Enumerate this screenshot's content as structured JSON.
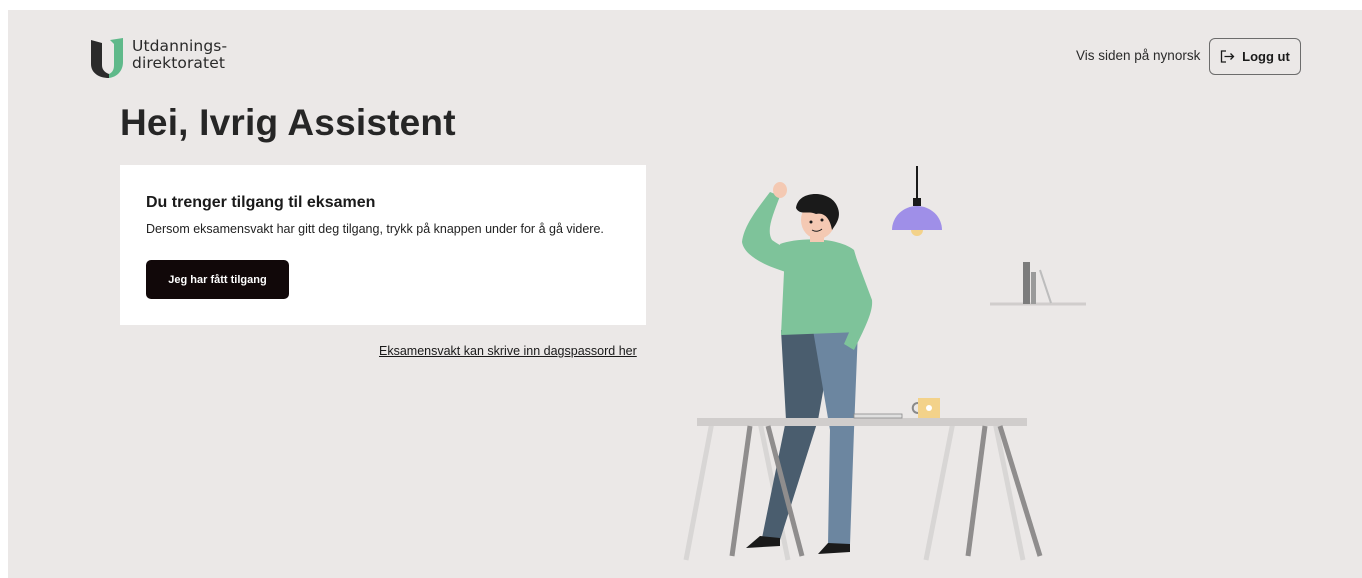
{
  "header": {
    "logo_line1": "Utdannings-",
    "logo_line2": "direktoratet",
    "language_link": "Vis siden på nynorsk",
    "logout_label": "Logg ut"
  },
  "main": {
    "greeting": "Hei, Ivrig Assistent",
    "card": {
      "title": "Du trenger tilgang til eksamen",
      "text": "Dersom eksamensvakt har gitt deg tilgang, trykk på knappen under for å gå videre.",
      "button_label": "Jeg har fått tilgang"
    },
    "code_link": "Eksamensvakt kan skrive inn dagspassord her"
  },
  "icons": {
    "logo": "udir-logo-icon",
    "logout": "logout-icon"
  },
  "colors": {
    "page_background": "#ebe8e7",
    "primary_button": "#110809",
    "logo_green": "#5fb98a",
    "logo_dark": "#2b2b2b"
  }
}
